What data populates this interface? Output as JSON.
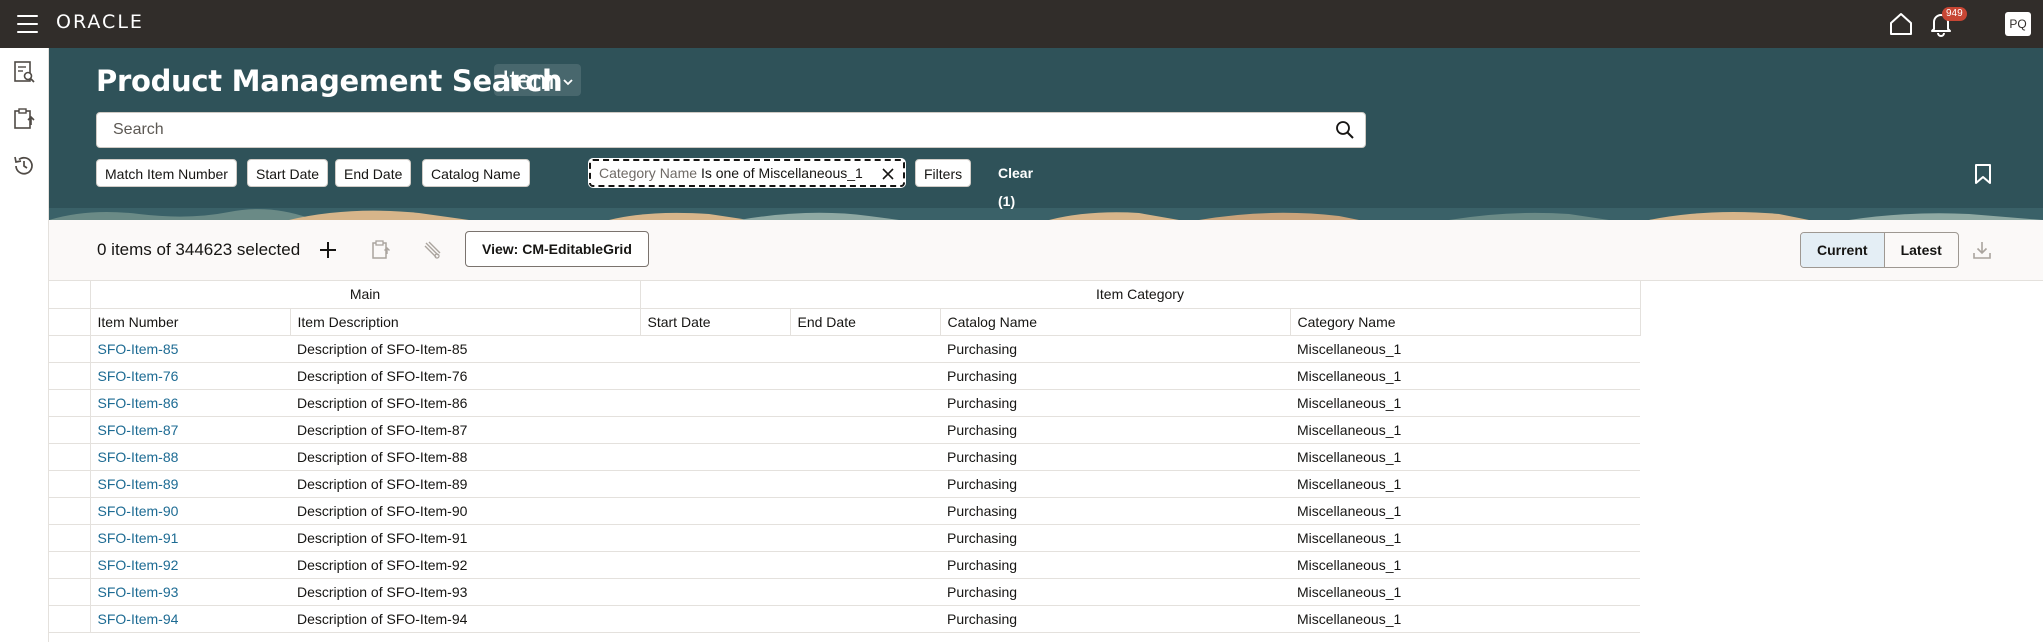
{
  "header": {
    "logo_text": "ORACLE",
    "notification_count": "949",
    "user_initials": "PQ"
  },
  "hero": {
    "title": "Product Management Search",
    "object_type": "Item",
    "search": {
      "placeholder": "Search",
      "value": ""
    },
    "filters": [
      {
        "label": "Match Item Number"
      },
      {
        "label": "Start Date"
      },
      {
        "label": "End Date"
      },
      {
        "label": "Catalog Name"
      }
    ],
    "active_filter": {
      "field": "Category Name",
      "operator_value": "Is one of Miscellaneous_1"
    },
    "filters_button": "Filters",
    "clear_label": "Clear (1)"
  },
  "toolbar": {
    "selection_text": "0 items of 344623 selected",
    "view_button": "View: CM-EditableGrid",
    "version_options": [
      "Current",
      "Latest"
    ],
    "selected_version": "Current"
  },
  "table": {
    "groups": [
      "Main",
      "Item Category"
    ],
    "columns": [
      "Item Number",
      "Item Description",
      "Start Date",
      "End Date",
      "Catalog Name",
      "Category Name"
    ],
    "rows": [
      [
        "SFO-Item-85",
        "Description of SFO-Item-85",
        "",
        "",
        "Purchasing",
        "Miscellaneous_1"
      ],
      [
        "SFO-Item-76",
        "Description of SFO-Item-76",
        "",
        "",
        "Purchasing",
        "Miscellaneous_1"
      ],
      [
        "SFO-Item-86",
        "Description of SFO-Item-86",
        "",
        "",
        "Purchasing",
        "Miscellaneous_1"
      ],
      [
        "SFO-Item-87",
        "Description of SFO-Item-87",
        "",
        "",
        "Purchasing",
        "Miscellaneous_1"
      ],
      [
        "SFO-Item-88",
        "Description of SFO-Item-88",
        "",
        "",
        "Purchasing",
        "Miscellaneous_1"
      ],
      [
        "SFO-Item-89",
        "Description of SFO-Item-89",
        "",
        "",
        "Purchasing",
        "Miscellaneous_1"
      ],
      [
        "SFO-Item-90",
        "Description of SFO-Item-90",
        "",
        "",
        "Purchasing",
        "Miscellaneous_1"
      ],
      [
        "SFO-Item-91",
        "Description of SFO-Item-91",
        "",
        "",
        "Purchasing",
        "Miscellaneous_1"
      ],
      [
        "SFO-Item-92",
        "Description of SFO-Item-92",
        "",
        "",
        "Purchasing",
        "Miscellaneous_1"
      ],
      [
        "SFO-Item-93",
        "Description of SFO-Item-93",
        "",
        "",
        "Purchasing",
        "Miscellaneous_1"
      ],
      [
        "SFO-Item-94",
        "Description of SFO-Item-94",
        "",
        "",
        "Purchasing",
        "Miscellaneous_1"
      ]
    ]
  },
  "colors": {
    "topbar": "#312d2a",
    "hero": "#2f5259",
    "link": "#1d6b93",
    "badge": "#c74634"
  }
}
